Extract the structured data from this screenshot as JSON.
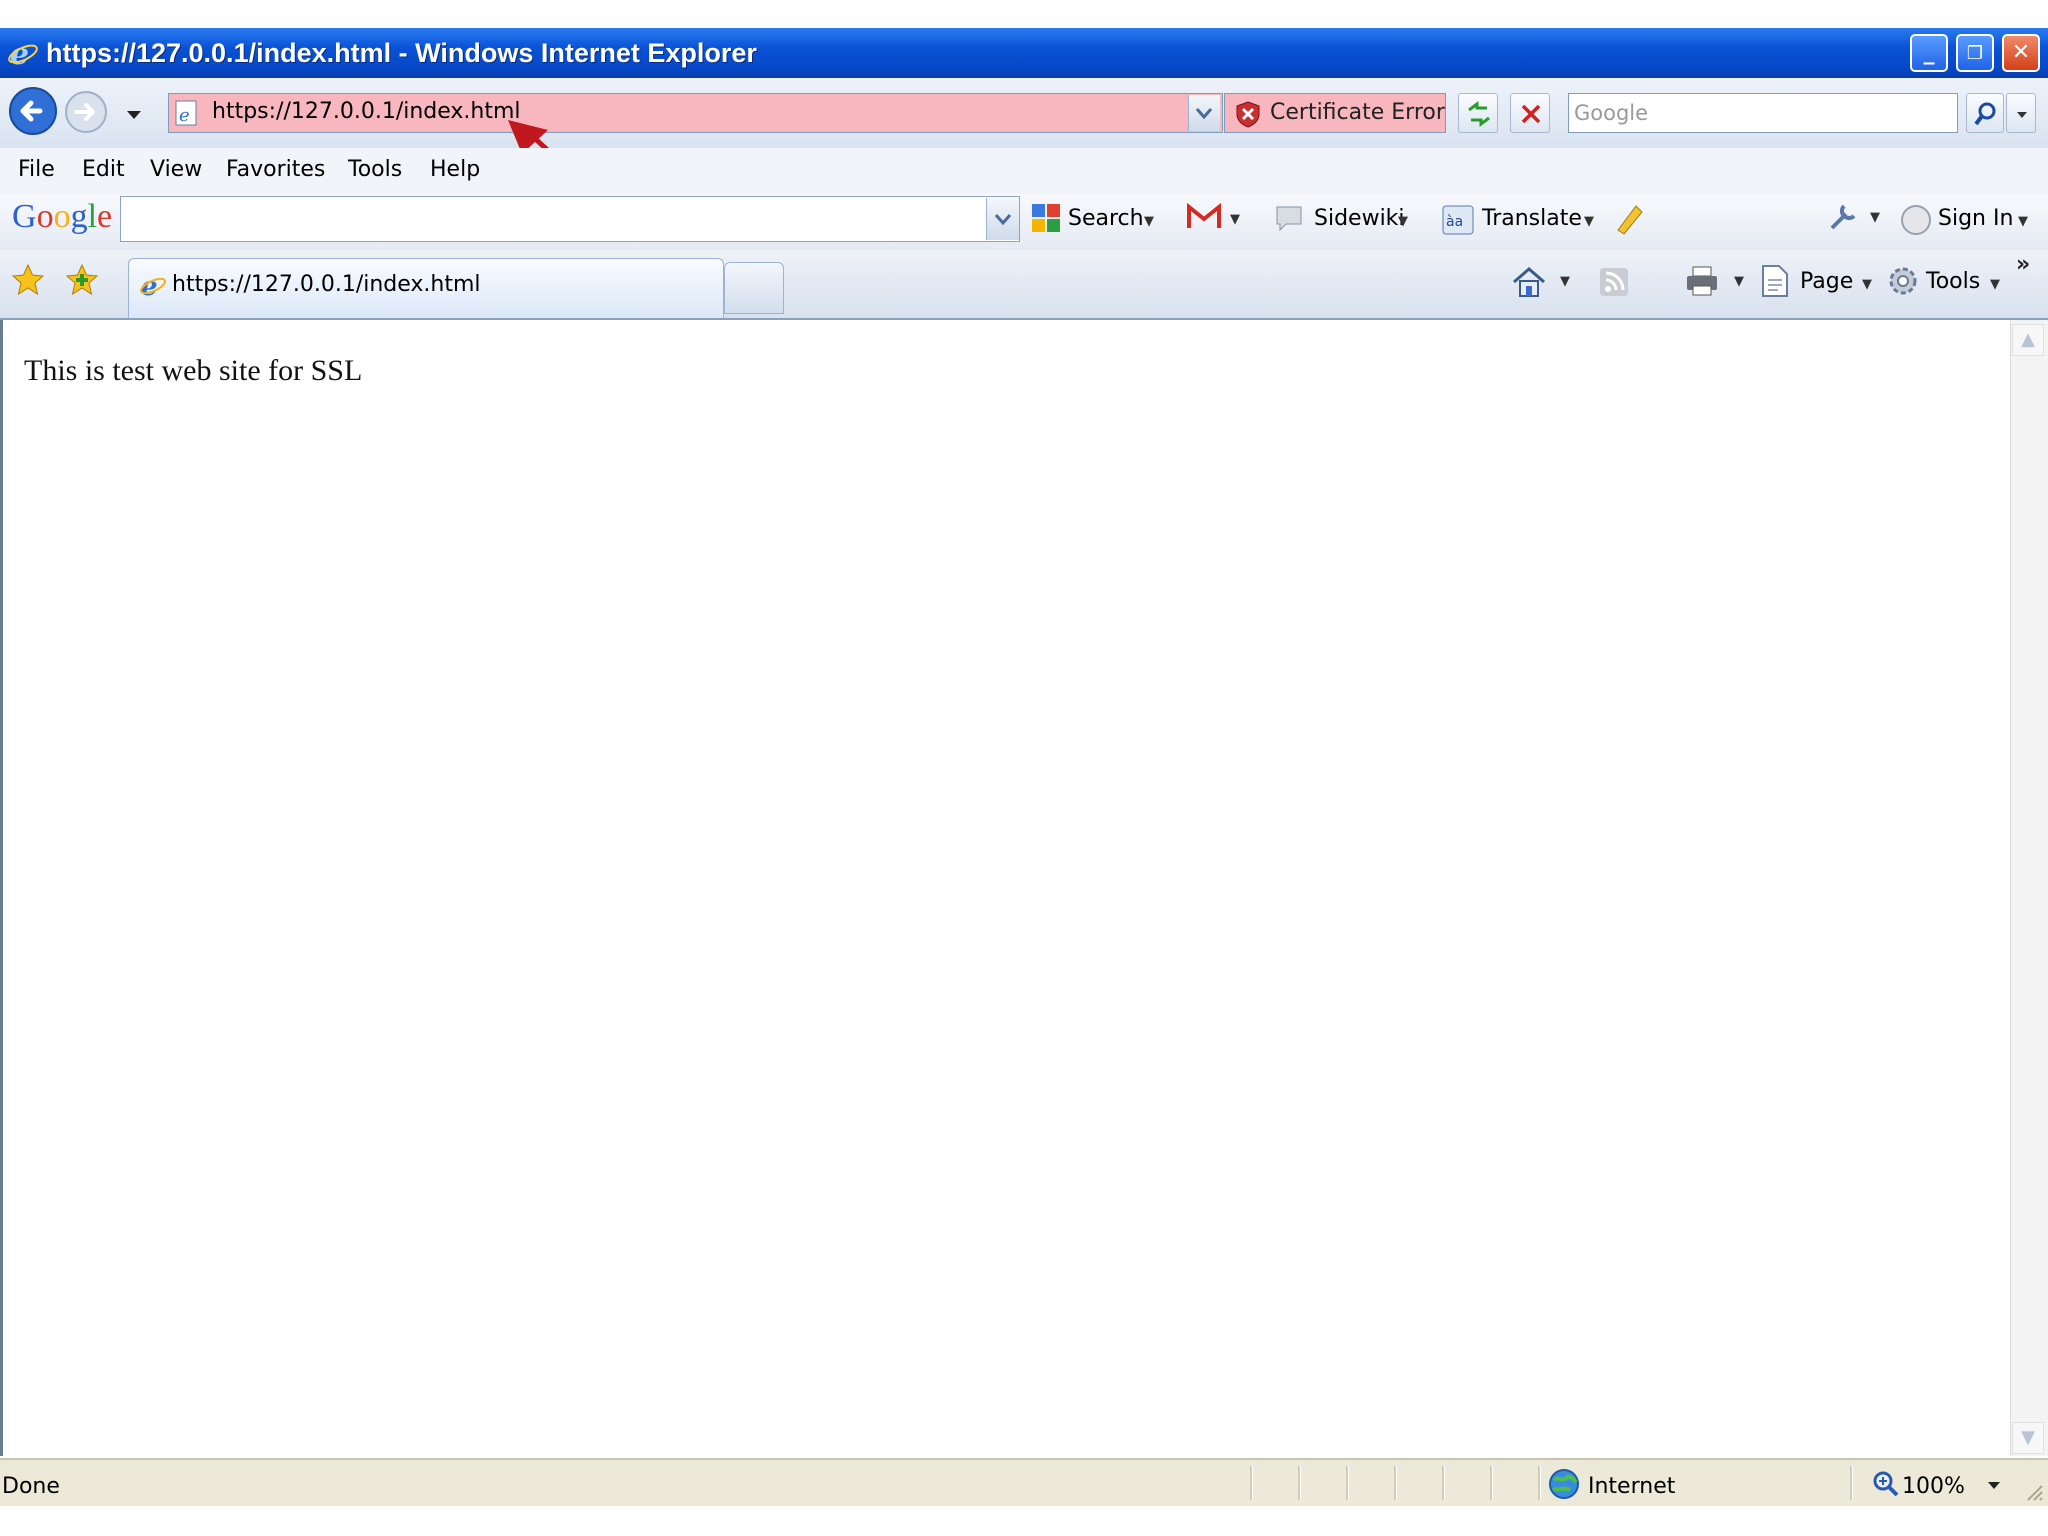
{
  "window": {
    "title": "https://127.0.0.1/index.html - Windows Internet Explorer"
  },
  "address_bar": {
    "url": "https://127.0.0.1/index.html",
    "certificate_label": "Certificate Error"
  },
  "search": {
    "placeholder": "Google"
  },
  "menu": {
    "items": [
      "File",
      "Edit",
      "View",
      "Favorites",
      "Tools",
      "Help"
    ]
  },
  "google_toolbar": {
    "logo": "Google",
    "search_label": "Search",
    "sidewiki_label": "Sidewiki",
    "translate_label": "Translate",
    "signin_label": "Sign In"
  },
  "tabs": {
    "active_title": "https://127.0.0.1/index.html"
  },
  "command_bar": {
    "page_label": "Page",
    "tools_label": "Tools"
  },
  "content": {
    "text": "This is test web site for SSL"
  },
  "status_bar": {
    "status": "Done",
    "zone": "Internet",
    "zoom": "100%"
  },
  "colors": {
    "titlebar": "#0a52d6",
    "address_error_bg": "#f8b6be",
    "annotation_arrow": "#c0181e"
  }
}
